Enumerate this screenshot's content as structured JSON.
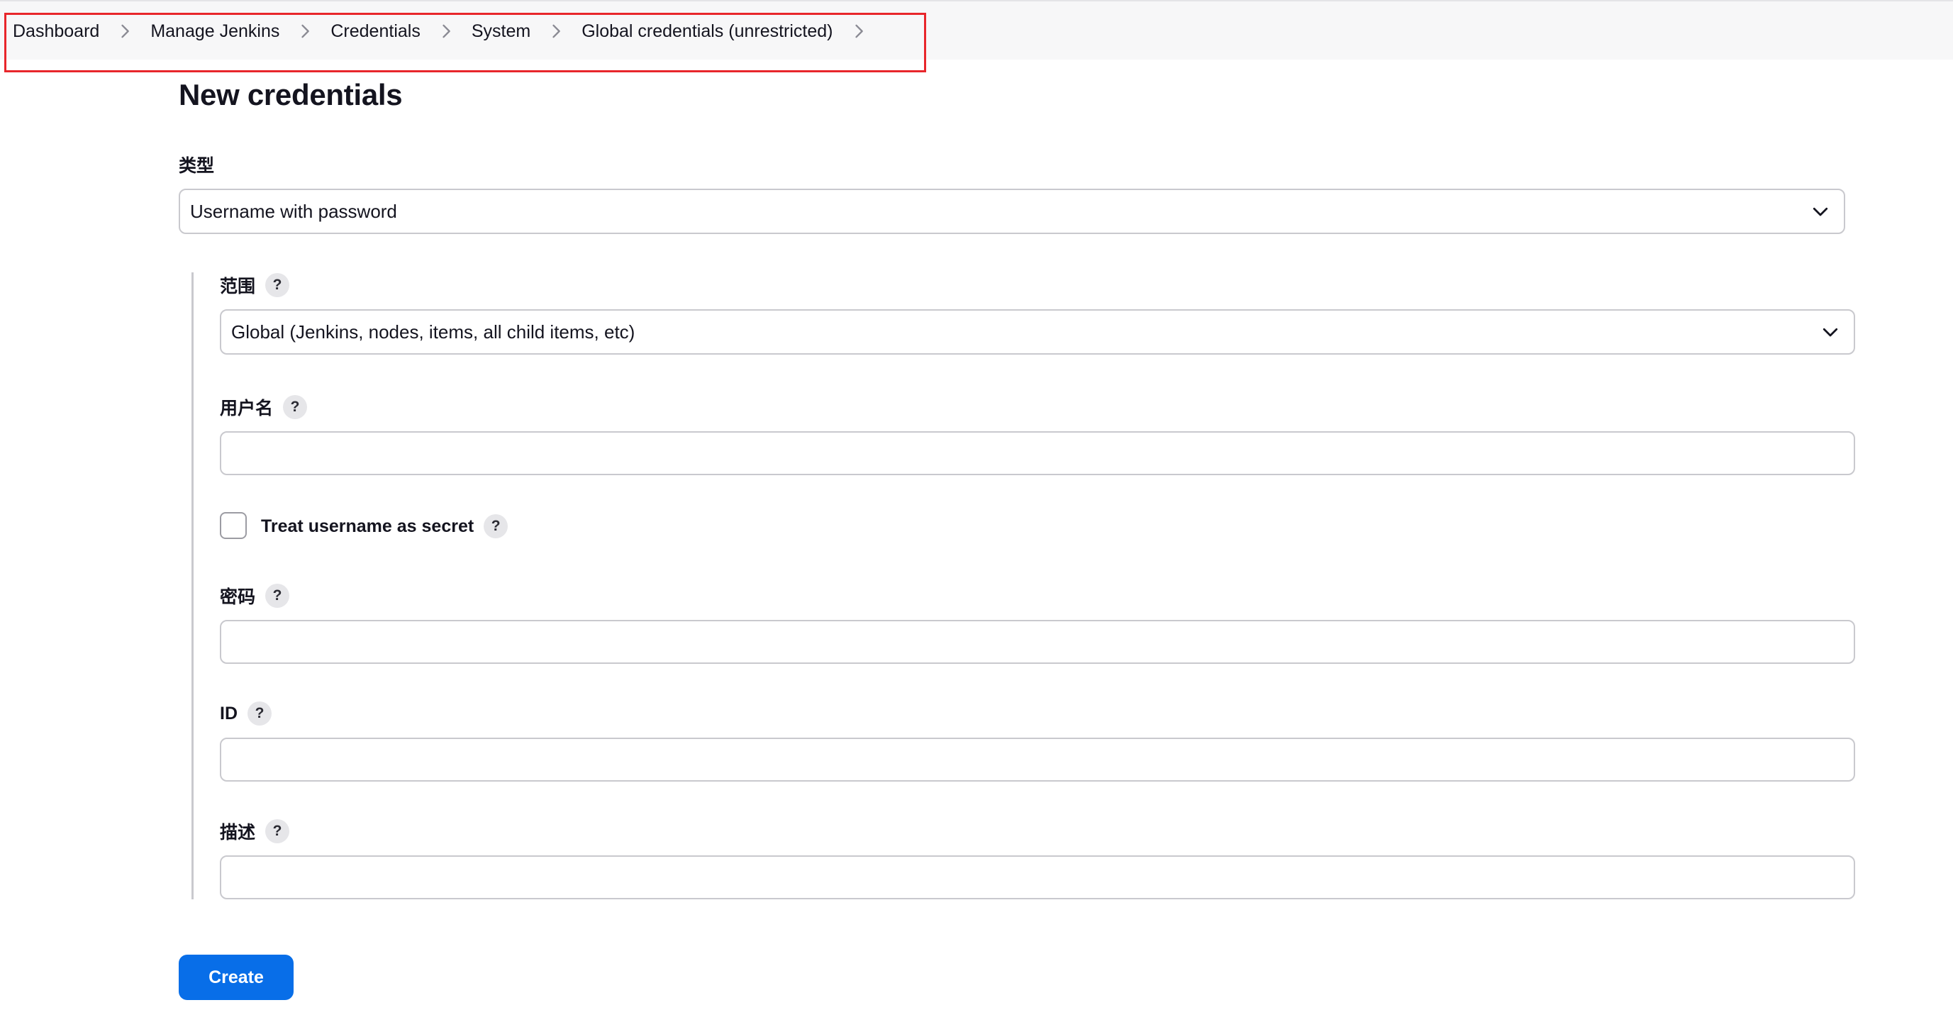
{
  "breadcrumb": {
    "items": [
      {
        "label": "Dashboard"
      },
      {
        "label": "Manage Jenkins"
      },
      {
        "label": "Credentials"
      },
      {
        "label": "System"
      },
      {
        "label": "Global credentials (unrestricted)"
      }
    ]
  },
  "page": {
    "title": "New credentials"
  },
  "form": {
    "kind": {
      "label": "类型",
      "value": "Username with password"
    },
    "scope": {
      "label": "范围",
      "value": "Global (Jenkins, nodes, items, all child items, etc)"
    },
    "username": {
      "label": "用户名",
      "value": ""
    },
    "username_secret": {
      "label": "Treat username as secret",
      "checked": false
    },
    "password": {
      "label": "密码",
      "value": ""
    },
    "id": {
      "label": "ID",
      "value": ""
    },
    "description": {
      "label": "描述",
      "value": ""
    },
    "help_glyph": "?",
    "create_label": "Create"
  },
  "colors": {
    "accent": "#086ee8",
    "highlight": "#e8262b",
    "border": "#c9c9ce",
    "topbar": "#f7f7f8"
  },
  "icons": {
    "breadcrumb_separator": "chevron-right-icon",
    "select_arrow": "chevron-down-icon"
  }
}
